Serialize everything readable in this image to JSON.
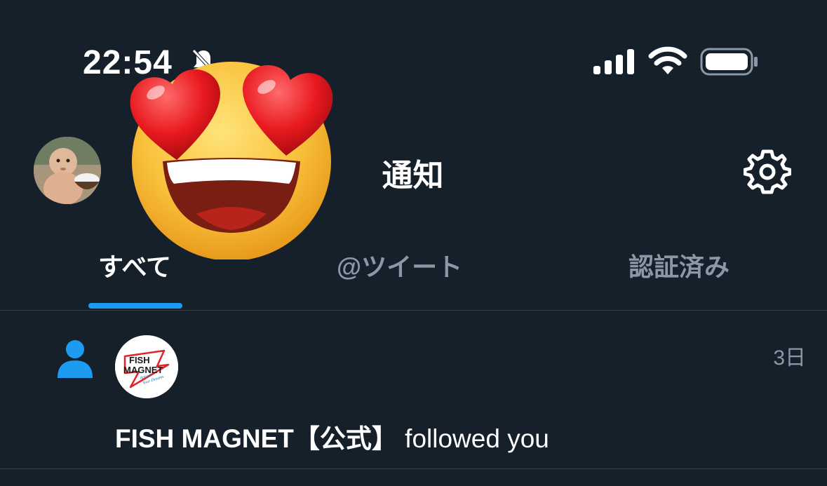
{
  "status_bar": {
    "time": "22:54",
    "icons": [
      "bell-muted-icon",
      "signal-icon",
      "wifi-icon",
      "battery-icon"
    ]
  },
  "header": {
    "title": "通知",
    "avatar_icon": "profile-avatar",
    "settings_icon": "gear-icon"
  },
  "tabs": [
    {
      "label": "すべて",
      "active": true
    },
    {
      "label": "@ツイート",
      "active": false
    },
    {
      "label": "認証済み",
      "active": false
    }
  ],
  "notifications": [
    {
      "type_icon": "person-icon",
      "account": "FISH MAGNET【公式】",
      "action": " followed you",
      "time": "3日",
      "avatar_text": {
        "line1": "FISH",
        "line2": "MAGNET",
        "tagline1": "Attract",
        "tagline2": "Your Dreams"
      }
    }
  ],
  "overlay": {
    "emoji": "heart-eyes-emoji-icon"
  },
  "colors": {
    "background": "#15202b",
    "accent": "#1d9bf0",
    "divider": "#38444d",
    "muted_text": "#8b98a5"
  }
}
